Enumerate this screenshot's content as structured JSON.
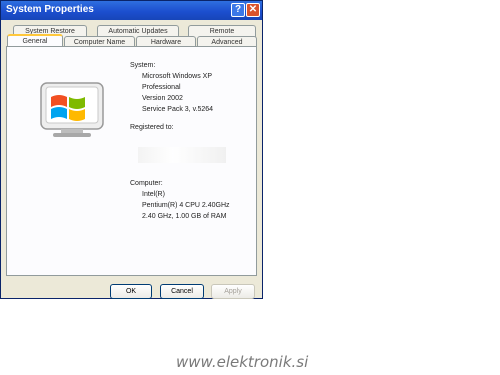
{
  "window": {
    "title": "System Properties"
  },
  "tabs_back": [
    "System Restore",
    "Automatic Updates",
    "Remote"
  ],
  "tabs_front": [
    "General",
    "Computer Name",
    "Hardware",
    "Advanced"
  ],
  "system": {
    "heading": "System:",
    "lines": [
      "Microsoft Windows XP",
      "Professional",
      "Version 2002",
      "Service Pack 3, v.5264"
    ]
  },
  "registered": {
    "heading": "Registered to:"
  },
  "computer": {
    "heading": "Computer:",
    "lines": [
      "Intel(R)",
      "Pentium(R) 4 CPU 2.40GHz",
      "2.40 GHz, 1.00 GB of RAM"
    ]
  },
  "buttons": {
    "ok": "OK",
    "cancel": "Cancel",
    "apply": "Apply"
  },
  "watermark": "www.elektronik.si",
  "icons": {
    "help": "help-icon",
    "close": "close-icon",
    "logo": "windows-logo-icon"
  }
}
